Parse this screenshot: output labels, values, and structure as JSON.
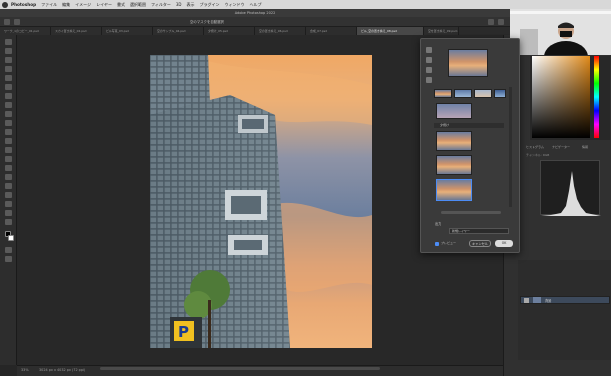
{
  "menubar": {
    "app_name": "Photoshop",
    "items": [
      "ファイル",
      "編集",
      "イメージ",
      "レイヤー",
      "書式",
      "選択範囲",
      "フィルター",
      "3D",
      "表示",
      "プラグイン",
      "ウィンドウ",
      "ヘルプ"
    ],
    "clock": ""
  },
  "window": {
    "title": "Adobe Photoshop 2022"
  },
  "options": {
    "center_title": "空のマスクを自動選択"
  },
  "tabs": [
    "ワーク_1のコピー_01.psd",
    "スカイ置き換え_02.psd",
    "ビル写真_03.psd",
    "空のサンプル_04.psd",
    "夕焼け_05.psd",
    "空の置き換え_06.psd",
    "合成_07.psd",
    "ビル_空の置き換え_08.psd",
    "空を置き換え_09.psd @ 33.3%"
  ],
  "status": {
    "zoom": "33%",
    "doc_size": "3024 px x 4032 px (72 ppi)"
  },
  "dialog": {
    "output_label": "出力",
    "output_select": "新規レイヤー",
    "preview_label": "プレビュー",
    "cancel_label": "キャンセル",
    "ok_label": "OK",
    "folder_label": "夕焼け"
  },
  "right_panel": {
    "color_tabs": [
      "カラー",
      "スウォッチ"
    ],
    "histogram_tabs": [
      "ヒストグラム",
      "ナビゲーター",
      "情報"
    ],
    "histogram_source": "チャンネル: RGB",
    "layers_tabs": [
      "レイヤー",
      "チャンネル",
      "パス"
    ],
    "layer_name": "背景"
  },
  "colors": {
    "accent": "#4c8cf5",
    "sky_orange": "#e8a874",
    "sky_blue": "#6c7f9e"
  }
}
